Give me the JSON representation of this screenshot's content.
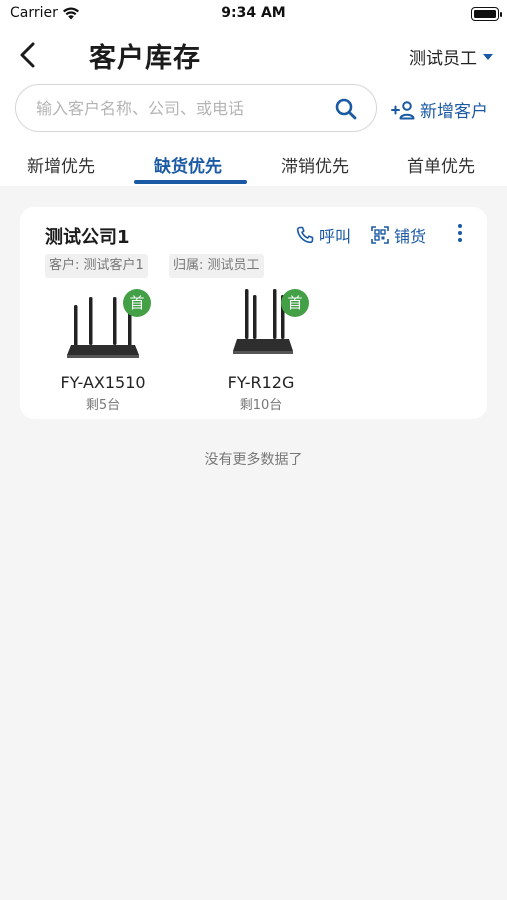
{
  "status": {
    "carrier": "Carrier",
    "time": "9:34 AM"
  },
  "nav": {
    "title": "客户库存",
    "staff": "测试员工"
  },
  "search": {
    "placeholder": "输入客户名称、公司、或电话"
  },
  "add_customer": "新增客户",
  "tabs": [
    {
      "label": "新增优先"
    },
    {
      "label": "缺货优先",
      "active": true
    },
    {
      "label": "滞销优先"
    },
    {
      "label": "首单优先"
    }
  ],
  "card": {
    "company": "测试公司1",
    "call_label": "呼叫",
    "stock_label": "铺货",
    "customer_tag": "客户: 测试客户1",
    "owner_tag": "归属: 测试员工",
    "products": [
      {
        "name": "FY-AX1510",
        "remaining": "剩5台",
        "badge": "首"
      },
      {
        "name": "FY-R12G",
        "remaining": "剩10台",
        "badge": "首"
      }
    ]
  },
  "footer": {
    "no_more": "没有更多数据了"
  },
  "colors": {
    "accent": "#1a5aa4",
    "badge": "#43a047",
    "background": "#f5f5f5"
  }
}
